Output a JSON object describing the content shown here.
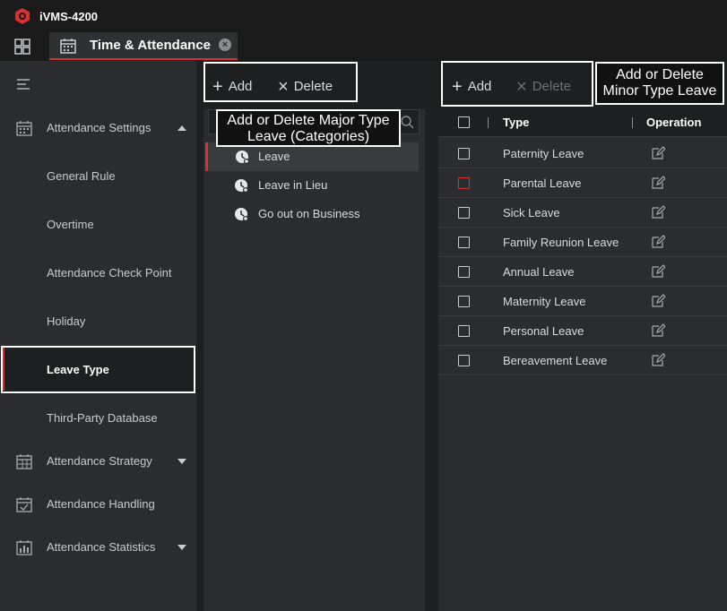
{
  "app": {
    "title": "iVMS-4200"
  },
  "tabs": [
    {
      "label": "Time & Attendance"
    }
  ],
  "sidebar": {
    "items": [
      {
        "label": "Attendance Settings"
      },
      {
        "label": "General Rule"
      },
      {
        "label": "Overtime"
      },
      {
        "label": "Attendance Check Point"
      },
      {
        "label": "Holiday"
      },
      {
        "label": "Leave Type"
      },
      {
        "label": "Third-Party Database"
      },
      {
        "label": "Attendance Strategy"
      },
      {
        "label": "Attendance Handling"
      },
      {
        "label": "Attendance Statistics"
      }
    ]
  },
  "major": {
    "add_label": "Add",
    "delete_label": "Delete",
    "categories": [
      "Leave",
      "Leave in Lieu",
      "Go out on Business"
    ],
    "selected": "Leave"
  },
  "minor": {
    "add_label": "Add",
    "delete_label": "Delete",
    "columns": {
      "type": "Type",
      "operation": "Operation"
    },
    "rows": [
      "Paternity Leave",
      "Parental Leave",
      "Sick Leave",
      "Family Reunion Leave",
      "Annual Leave",
      "Maternity Leave",
      "Personal Leave",
      "Bereavement Leave"
    ]
  },
  "annotations": {
    "major_line1": "Add or Delete Major Type",
    "major_line2": "Leave (Categories)",
    "minor_line1": "Add or Delete",
    "minor_line2": "Minor Type Leave"
  },
  "colors": {
    "accent": "#d8302f",
    "background": "#1e1f21",
    "panel": "#2b2c2f"
  }
}
